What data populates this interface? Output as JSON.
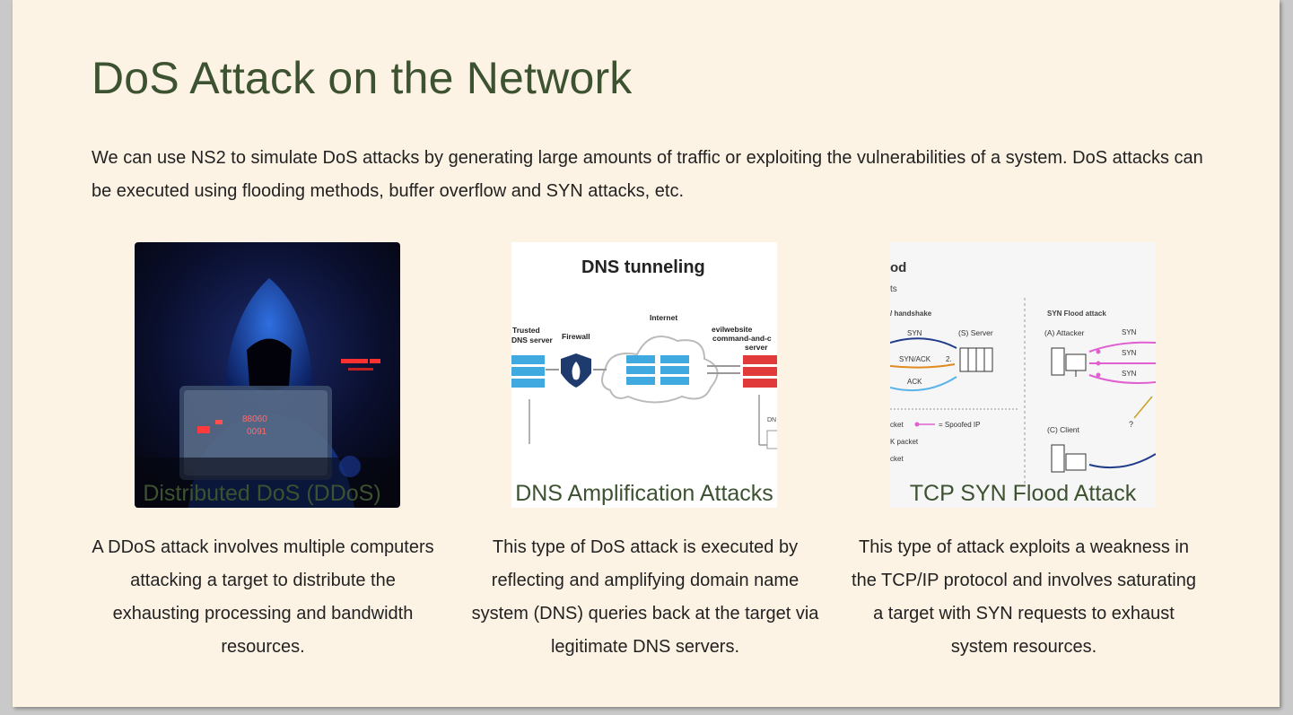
{
  "slide": {
    "title": "DoS Attack on the Network",
    "intro": "We can use NS2 to simulate DoS attacks by generating large amounts of traffic or exploiting the vulnerabilities of a system. DoS attacks can be executed using flooding methods, buffer overflow and SYN attacks, etc."
  },
  "cards": [
    {
      "title": "Distributed DoS (DDoS)",
      "description": "A DDoS attack involves multiple computers attacking a target to distribute the exhausting processing and bandwidth resources.",
      "image": {
        "icon": "hooded-hacker-laptop-image"
      }
    },
    {
      "title": "DNS Amplification Attacks",
      "description": "This type of DoS attack is executed by reflecting and amplifying domain name system (DNS) queries back at the target via legitimate DNS servers.",
      "image": {
        "heading": "DNS tunneling",
        "labels": {
          "trusted": "Trusted",
          "dns_server": "DNS server",
          "firewall": "Firewall",
          "internet": "Internet",
          "evil1": "evilwebsite",
          "evil2": "command-and-c",
          "evil3": "server",
          "dn": "DN"
        }
      }
    },
    {
      "title": "TCP SYN Flood Attack",
      "description": "This type of attack exploits a weakness in the TCP/IP protocol and involves saturating a target with SYN requests to exhaust system resources.",
      "image": {
        "labels": {
          "od": "od",
          "ts": "ts",
          "handshake": "/ handshake",
          "server": "(S) Server",
          "syn": "SYN",
          "synack": "SYN/ACK",
          "two": "2.",
          "ack": "ACK",
          "flood": "SYN Flood attack",
          "attacker": "(A) Attacker",
          "cket": "cket",
          "spoofed": "= Spoofed IP",
          "kpacket": "K packet",
          "client": "(C) Client",
          "q": "?"
        }
      }
    }
  ],
  "colors": {
    "background": "#fdf3e4",
    "title": "#3c5230",
    "text": "#222222"
  }
}
